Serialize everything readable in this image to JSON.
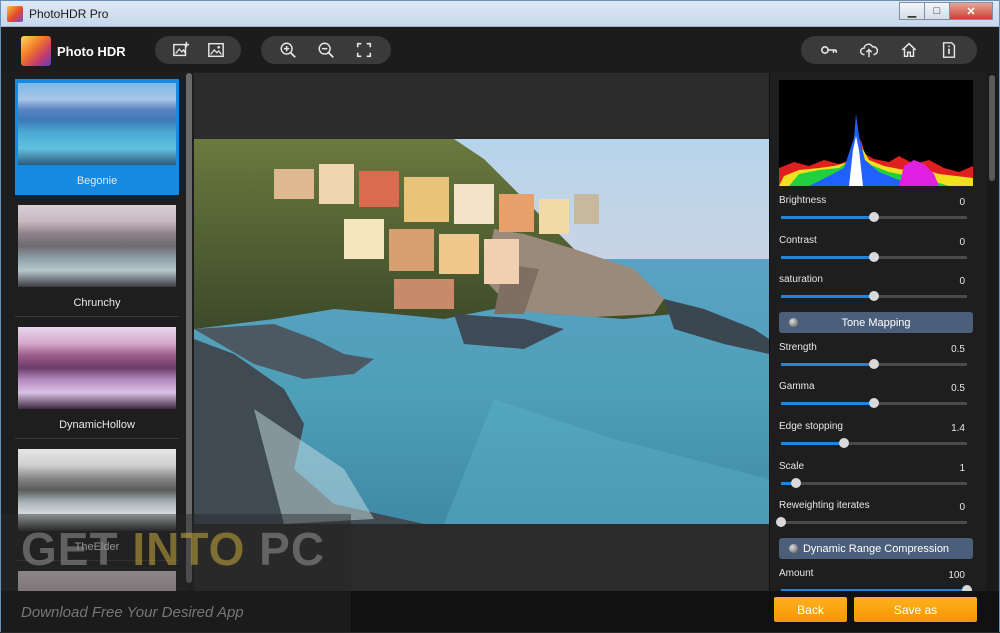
{
  "window": {
    "title": "PhotoHDR Pro",
    "controls": {
      "minimize": "▁",
      "maximize": "□",
      "close": "✕"
    }
  },
  "app": {
    "name": "Photo HDR"
  },
  "toolbar": {
    "left_icons": [
      "add-image-icon",
      "image-icon"
    ],
    "zoom_icons": [
      "zoom-in-icon",
      "zoom-out-icon",
      "fullscreen-icon"
    ],
    "right_icons": [
      "key-icon",
      "upload-cloud-icon",
      "home-icon",
      "info-icon"
    ]
  },
  "presets": [
    {
      "label": "Begonie",
      "selected": true
    },
    {
      "label": "Chrunchy",
      "selected": false
    },
    {
      "label": "DynamicHollow",
      "selected": false
    },
    {
      "label": "TheElder",
      "selected": false
    }
  ],
  "adjustments": {
    "brightness": {
      "label": "Brightness",
      "value": "0",
      "fraction": 0.5
    },
    "contrast": {
      "label": "Contrast",
      "value": "0",
      "fraction": 0.5
    },
    "saturation": {
      "label": "saturation",
      "value": "0",
      "fraction": 0.5
    }
  },
  "tone_mapping": {
    "header": "Tone Mapping",
    "strength": {
      "label": "Strength",
      "value": "0.5",
      "fraction": 0.5
    },
    "gamma": {
      "label": "Gamma",
      "value": "0.5",
      "fraction": 0.5
    },
    "edge_stopping": {
      "label": "Edge stopping",
      "value": "1.4",
      "fraction": 0.34
    },
    "scale": {
      "label": "Scale",
      "value": "1",
      "fraction": 0.08
    },
    "reweighting": {
      "label": "Reweighting iterates",
      "value": "0",
      "fraction": 0.0
    }
  },
  "drc": {
    "header": "Dynamic Range Compression",
    "amount": {
      "label": "Amount",
      "value": "100",
      "fraction": 1.0
    }
  },
  "buttons": {
    "back": "Back",
    "save": "Save as"
  },
  "watermark": {
    "line1_a": "GET ",
    "line1_b": "INTO",
    "line1_c": " PC",
    "line2": "Download Free Your Desired App"
  },
  "colors": {
    "accent": "#1f86e0",
    "button": "#f39700",
    "section": "#4c5f7a"
  }
}
